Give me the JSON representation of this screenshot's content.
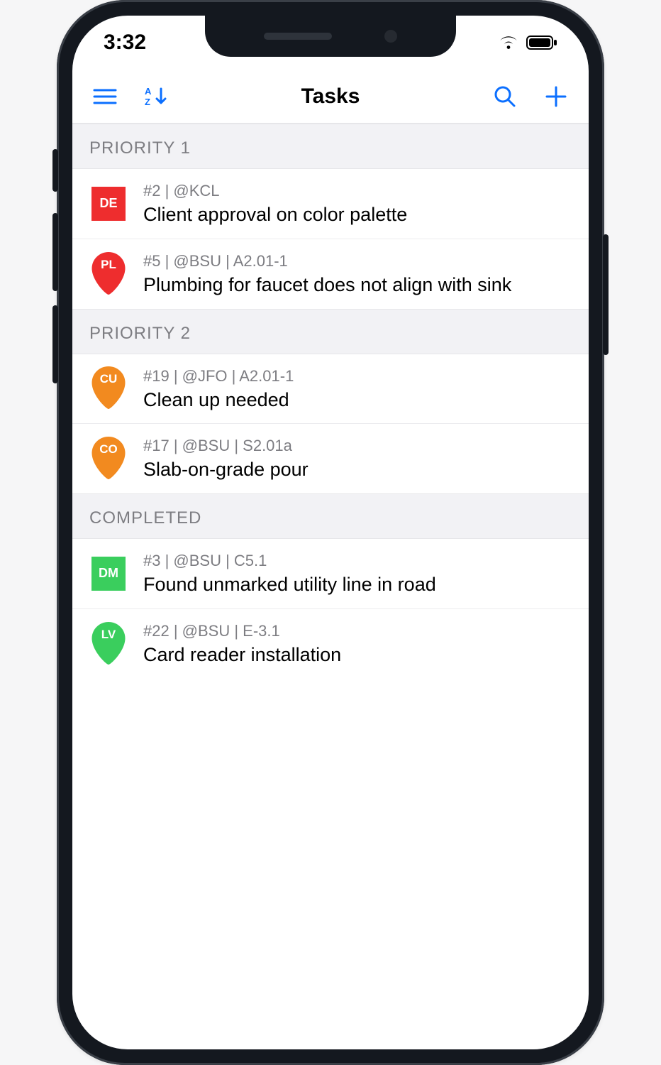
{
  "status": {
    "time": "3:32"
  },
  "nav": {
    "title": "Tasks"
  },
  "colors": {
    "accent": "#0b6fff",
    "red": "#ee2d2e",
    "orange": "#f28a1f",
    "green": "#3ace5d"
  },
  "sections": [
    {
      "label": "PRIORITY 1",
      "items": [
        {
          "shape": "square",
          "color": "red",
          "code": "DE",
          "meta": "#2 | @KCL",
          "title": "Client approval on color palette"
        },
        {
          "shape": "pin",
          "color": "red",
          "code": "PL",
          "meta": "#5 | @BSU | A2.01-1",
          "title": "Plumbing for faucet does not align with sink"
        }
      ]
    },
    {
      "label": "PRIORITY 2",
      "items": [
        {
          "shape": "pin",
          "color": "orange",
          "code": "CU",
          "meta": "#19 | @JFO | A2.01-1",
          "title": "Clean up needed"
        },
        {
          "shape": "pin",
          "color": "orange",
          "code": "CO",
          "meta": "#17 | @BSU | S2.01a",
          "title": "Slab-on-grade pour"
        }
      ]
    },
    {
      "label": "COMPLETED",
      "items": [
        {
          "shape": "square",
          "color": "green",
          "code": "DM",
          "meta": "#3 | @BSU | C5.1",
          "title": "Found unmarked utility line in road"
        },
        {
          "shape": "pin",
          "color": "green",
          "code": "LV",
          "meta": "#22 | @BSU | E-3.1",
          "title": "Card reader installation"
        }
      ]
    }
  ]
}
